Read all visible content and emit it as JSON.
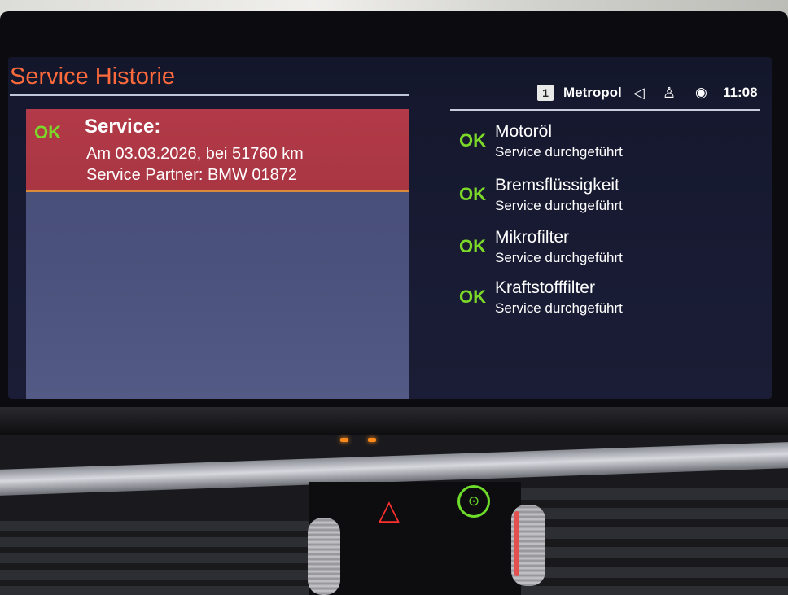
{
  "header": {
    "title": "Service Historie"
  },
  "status_bar": {
    "profile_number": "1",
    "station": "Metropol",
    "time": "11:08",
    "icons": [
      "speaker-icon",
      "user-icon",
      "globe-icon"
    ]
  },
  "selected_entry": {
    "status": "OK",
    "title": "Service:",
    "line1": "Am 03.03.2026, bei 51760 km",
    "line2": "Service Partner: BMW 01872"
  },
  "service_items": [
    {
      "status": "OK",
      "name": "Motoröl",
      "detail": "Service durchgeführt"
    },
    {
      "status": "OK",
      "name": "Bremsflüssigkeit",
      "detail": "Service durchgeführt"
    },
    {
      "status": "OK",
      "name": "Mikrofilter",
      "detail": "Service durchgeführt"
    },
    {
      "status": "OK",
      "name": "Kraftstofffilter",
      "detail": "Service durchgeführt"
    }
  ],
  "controls": {
    "hazard_icon": "hazard-triangle-icon",
    "assist_icon": "driving-assistant-icon"
  },
  "colors": {
    "title_orange": "#ff6a3c",
    "ok_green": "#7bd829",
    "selection_red": "#b33a48",
    "panel_blue": "#4a517c"
  }
}
